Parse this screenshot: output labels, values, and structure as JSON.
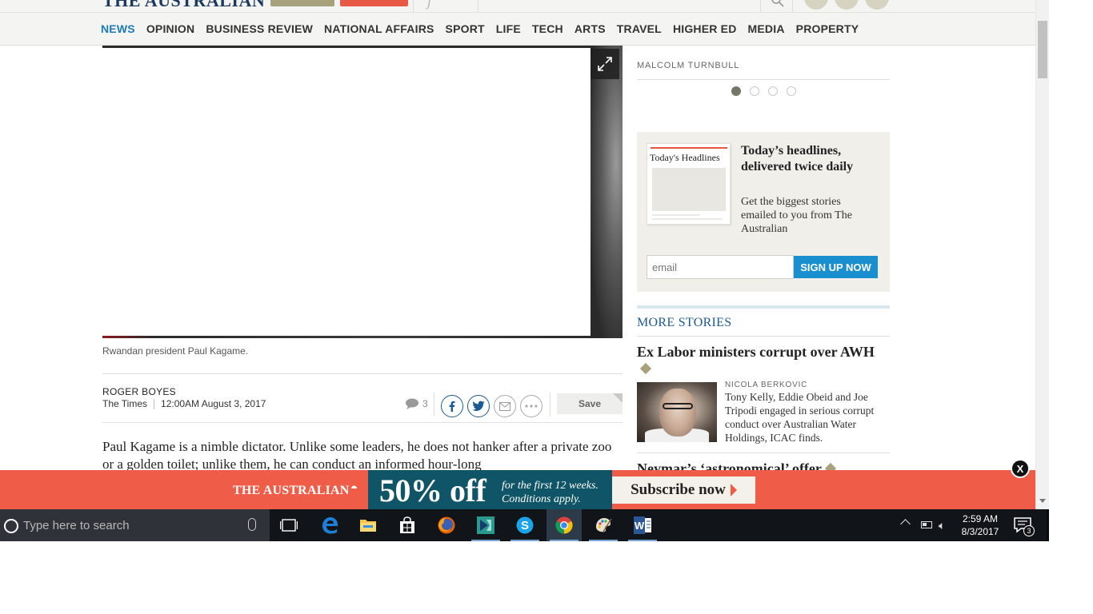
{
  "masthead": {
    "logo": "THE AUSTRALIAN"
  },
  "nav": {
    "items": [
      "NEWS",
      "OPINION",
      "BUSINESS REVIEW",
      "NATIONAL AFFAIRS",
      "SPORT",
      "LIFE",
      "TECH",
      "ARTS",
      "TRAVEL",
      "HIGHER ED",
      "MEDIA",
      "PROPERTY"
    ],
    "active": "NEWS",
    "active_color": "#1c7bb8"
  },
  "article": {
    "caption": "Rwandan president Paul Kagame.",
    "author": "ROGER BOYES",
    "source": "The Times",
    "timestamp": "12:00AM August 3, 2017",
    "comment_count": "3",
    "save_label": "Save",
    "body": "Paul Kagame is a nimble dictator. Unlike some leaders, he does not hanker after a private zoo or a golden toilet; unlike them, he can conduct an informed hour-long"
  },
  "sidebar": {
    "author_label": "MALCOLM TURNBULL",
    "carousel": {
      "count": 4,
      "active": 0
    },
    "newsletter": {
      "thumb_title": "Today's Headlines",
      "title": "Today’s headlines, delivered twice daily",
      "description": "Get the biggest stories emailed to you from The Australian",
      "email_placeholder": "email",
      "signup_label": "SIGN UP NOW"
    },
    "more_stories": {
      "title": "MORE STORIES",
      "stories": [
        {
          "title": "Ex Labor ministers corrupt over AWH",
          "author": "NICOLA BERKOVIC",
          "summary": "Tony Kelly, Eddie Obeid and Joe Tripodi engaged in serious corrupt conduct over Australian Water Holdings, ICAC finds."
        },
        {
          "title": "Neymar’s ‘astronomical’ offer"
        }
      ]
    }
  },
  "banner": {
    "logo": "THE AUSTRALIAN",
    "discount": "50% off",
    "terms": "for the first 12 weeks. Conditions apply.",
    "cta": "Subscribe now",
    "close": "X",
    "color": "#ef5d49",
    "offer_color": "#0f5567"
  },
  "taskbar": {
    "search_placeholder": "Type here to search",
    "apps": [
      "task-view",
      "edge",
      "file-explorer",
      "store",
      "firefox",
      "media-app",
      "skype",
      "chrome",
      "paint",
      "word"
    ],
    "active_app": "chrome",
    "time": "2:59 AM",
    "date": "8/3/2017",
    "notification_count": "3"
  }
}
